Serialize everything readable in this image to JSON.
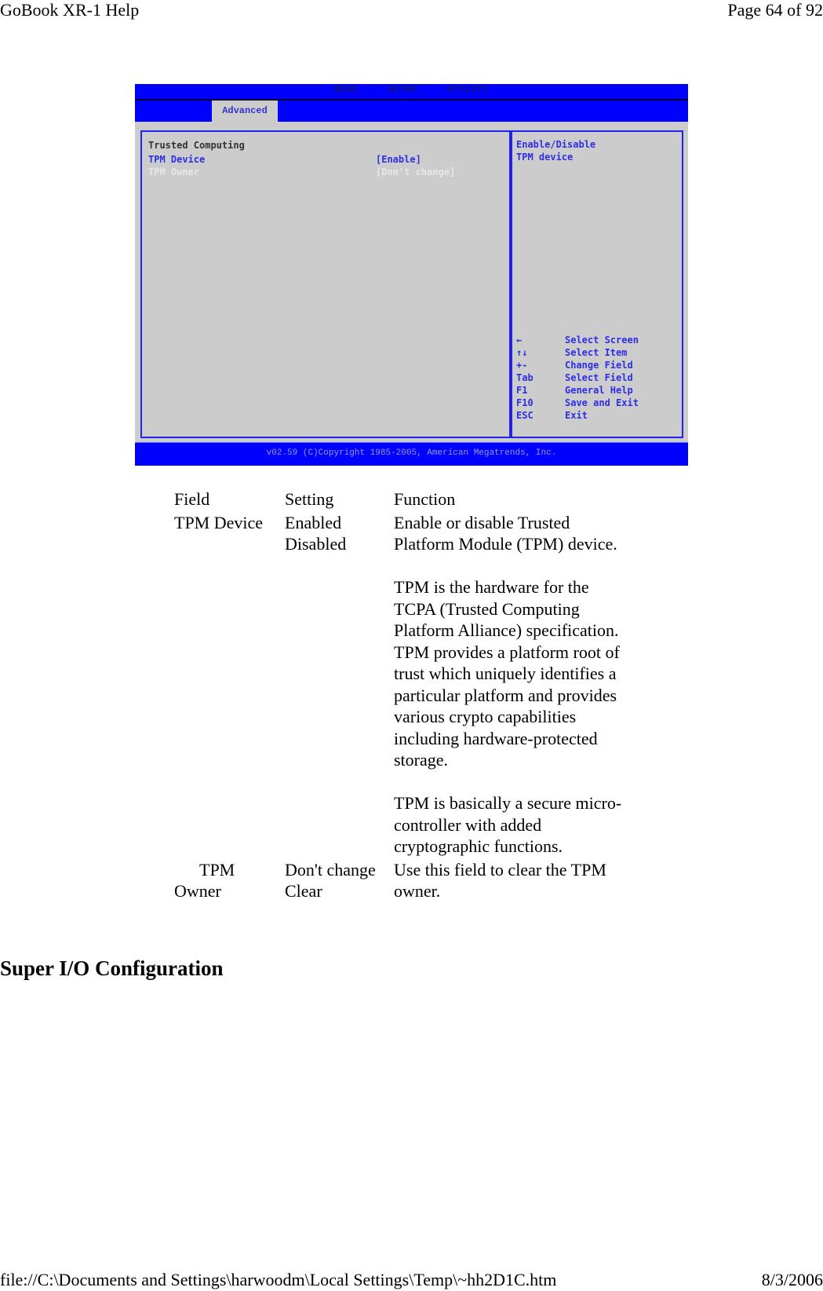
{
  "page_header": {
    "title": "GoBook XR-1 Help",
    "page_indicator": "Page 64 of 92"
  },
  "page_footer": {
    "file_path": "file://C:\\Documents and Settings\\harwoodm\\Local Settings\\Temp\\~hh2D1C.htm",
    "date": "8/3/2006"
  },
  "bios": {
    "title_items": [
      "BIOS",
      "SETUP",
      "UTILITY"
    ],
    "active_tab": "Advanced",
    "section_title": "Trusted Computing",
    "items": [
      {
        "label": "TPM Device",
        "value": "[Enable]",
        "state": "selected"
      },
      {
        "label": "TPM Owner",
        "value": "[Don't change]",
        "state": "disabled"
      }
    ],
    "help_text": [
      "Enable/Disable",
      "TPM device"
    ],
    "key_help": [
      {
        "key": "←",
        "action": "Select Screen"
      },
      {
        "key": "↑↓",
        "action": "Select Item"
      },
      {
        "key": "+-",
        "action": "Change Field"
      },
      {
        "key": "Tab",
        "action": "Select Field"
      },
      {
        "key": "F1",
        "action": "General Help"
      },
      {
        "key": "F10",
        "action": "Save and Exit"
      },
      {
        "key": "ESC",
        "action": "Exit"
      }
    ],
    "footer": "v02.59 (C)Copyright 1985-2005, American Megatrends, Inc.",
    "colors": {
      "bar": "#0000ff",
      "panel": "#cccccc",
      "highlight": "#2e2ee6"
    }
  },
  "table": {
    "headers": [
      "Field",
      "Setting",
      "Function"
    ],
    "rows": [
      {
        "field": "TPM Device",
        "settings": [
          "Enabled",
          "Disabled"
        ],
        "function_paragraphs": [
          "Enable or disable Trusted Platform Module (TPM) device.",
          "TPM is the hardware for the TCPA (Trusted Computing Platform Alliance) specification. TPM provides a platform root of trust which uniquely identifies a particular platform and provides various crypto capabilities including hardware-protected storage.",
          "TPM is basically a secure micro-controller with added cryptographic functions."
        ]
      },
      {
        "field_lines": [
          "TPM",
          "Owner"
        ],
        "settings": [
          "Don't change",
          "Clear"
        ],
        "function_paragraphs": [
          "Use this field to clear the TPM owner."
        ]
      }
    ]
  },
  "section_heading": "Super I/O Configuration"
}
